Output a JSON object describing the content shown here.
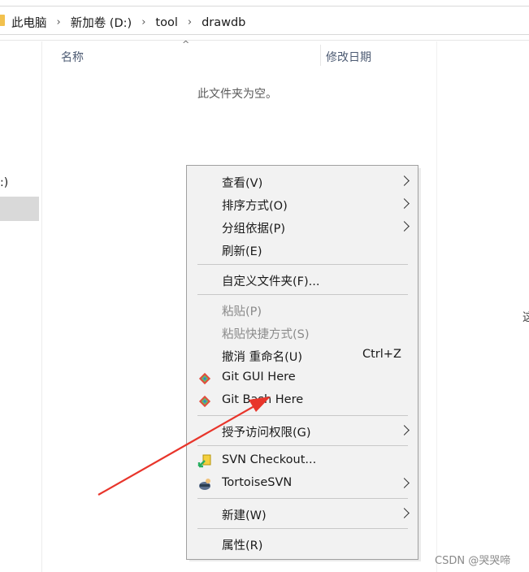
{
  "breadcrumb": [
    "此电脑",
    "新加卷 (D:)",
    "tool",
    "drawdb"
  ],
  "nav": {
    "fragment": ":)"
  },
  "columns": {
    "name": "名称",
    "date": "修改日期",
    "sort_caret": "^"
  },
  "empty_message": "此文件夹为空。",
  "right_fragment": "这",
  "menu": {
    "view": "查看(V)",
    "sort": "排序方式(O)",
    "group": "分组依据(P)",
    "refresh": "刷新(E)",
    "customize": "自定义文件夹(F)...",
    "paste": "粘贴(P)",
    "paste_shortcut": "粘贴快捷方式(S)",
    "undo_rename": "撤消 重命名(U)",
    "undo_shortcut": "Ctrl+Z",
    "git_gui": "Git GUI Here",
    "git_bash": "Git Bash Here",
    "grant_access": "授予访问权限(G)",
    "svn_checkout": "SVN Checkout...",
    "tortoise": "TortoiseSVN",
    "new": "新建(W)",
    "properties": "属性(R)"
  },
  "icons": {
    "git": "git-diamond-icon",
    "svn_checkout": "svn-checkout-icon",
    "tortoise": "tortoise-icon"
  },
  "colors": {
    "arrow": "#e8352b",
    "menu_bg": "#f2f2f2",
    "disabled_text": "#8a8a8a"
  },
  "watermark": "CSDN @哭哭啼"
}
